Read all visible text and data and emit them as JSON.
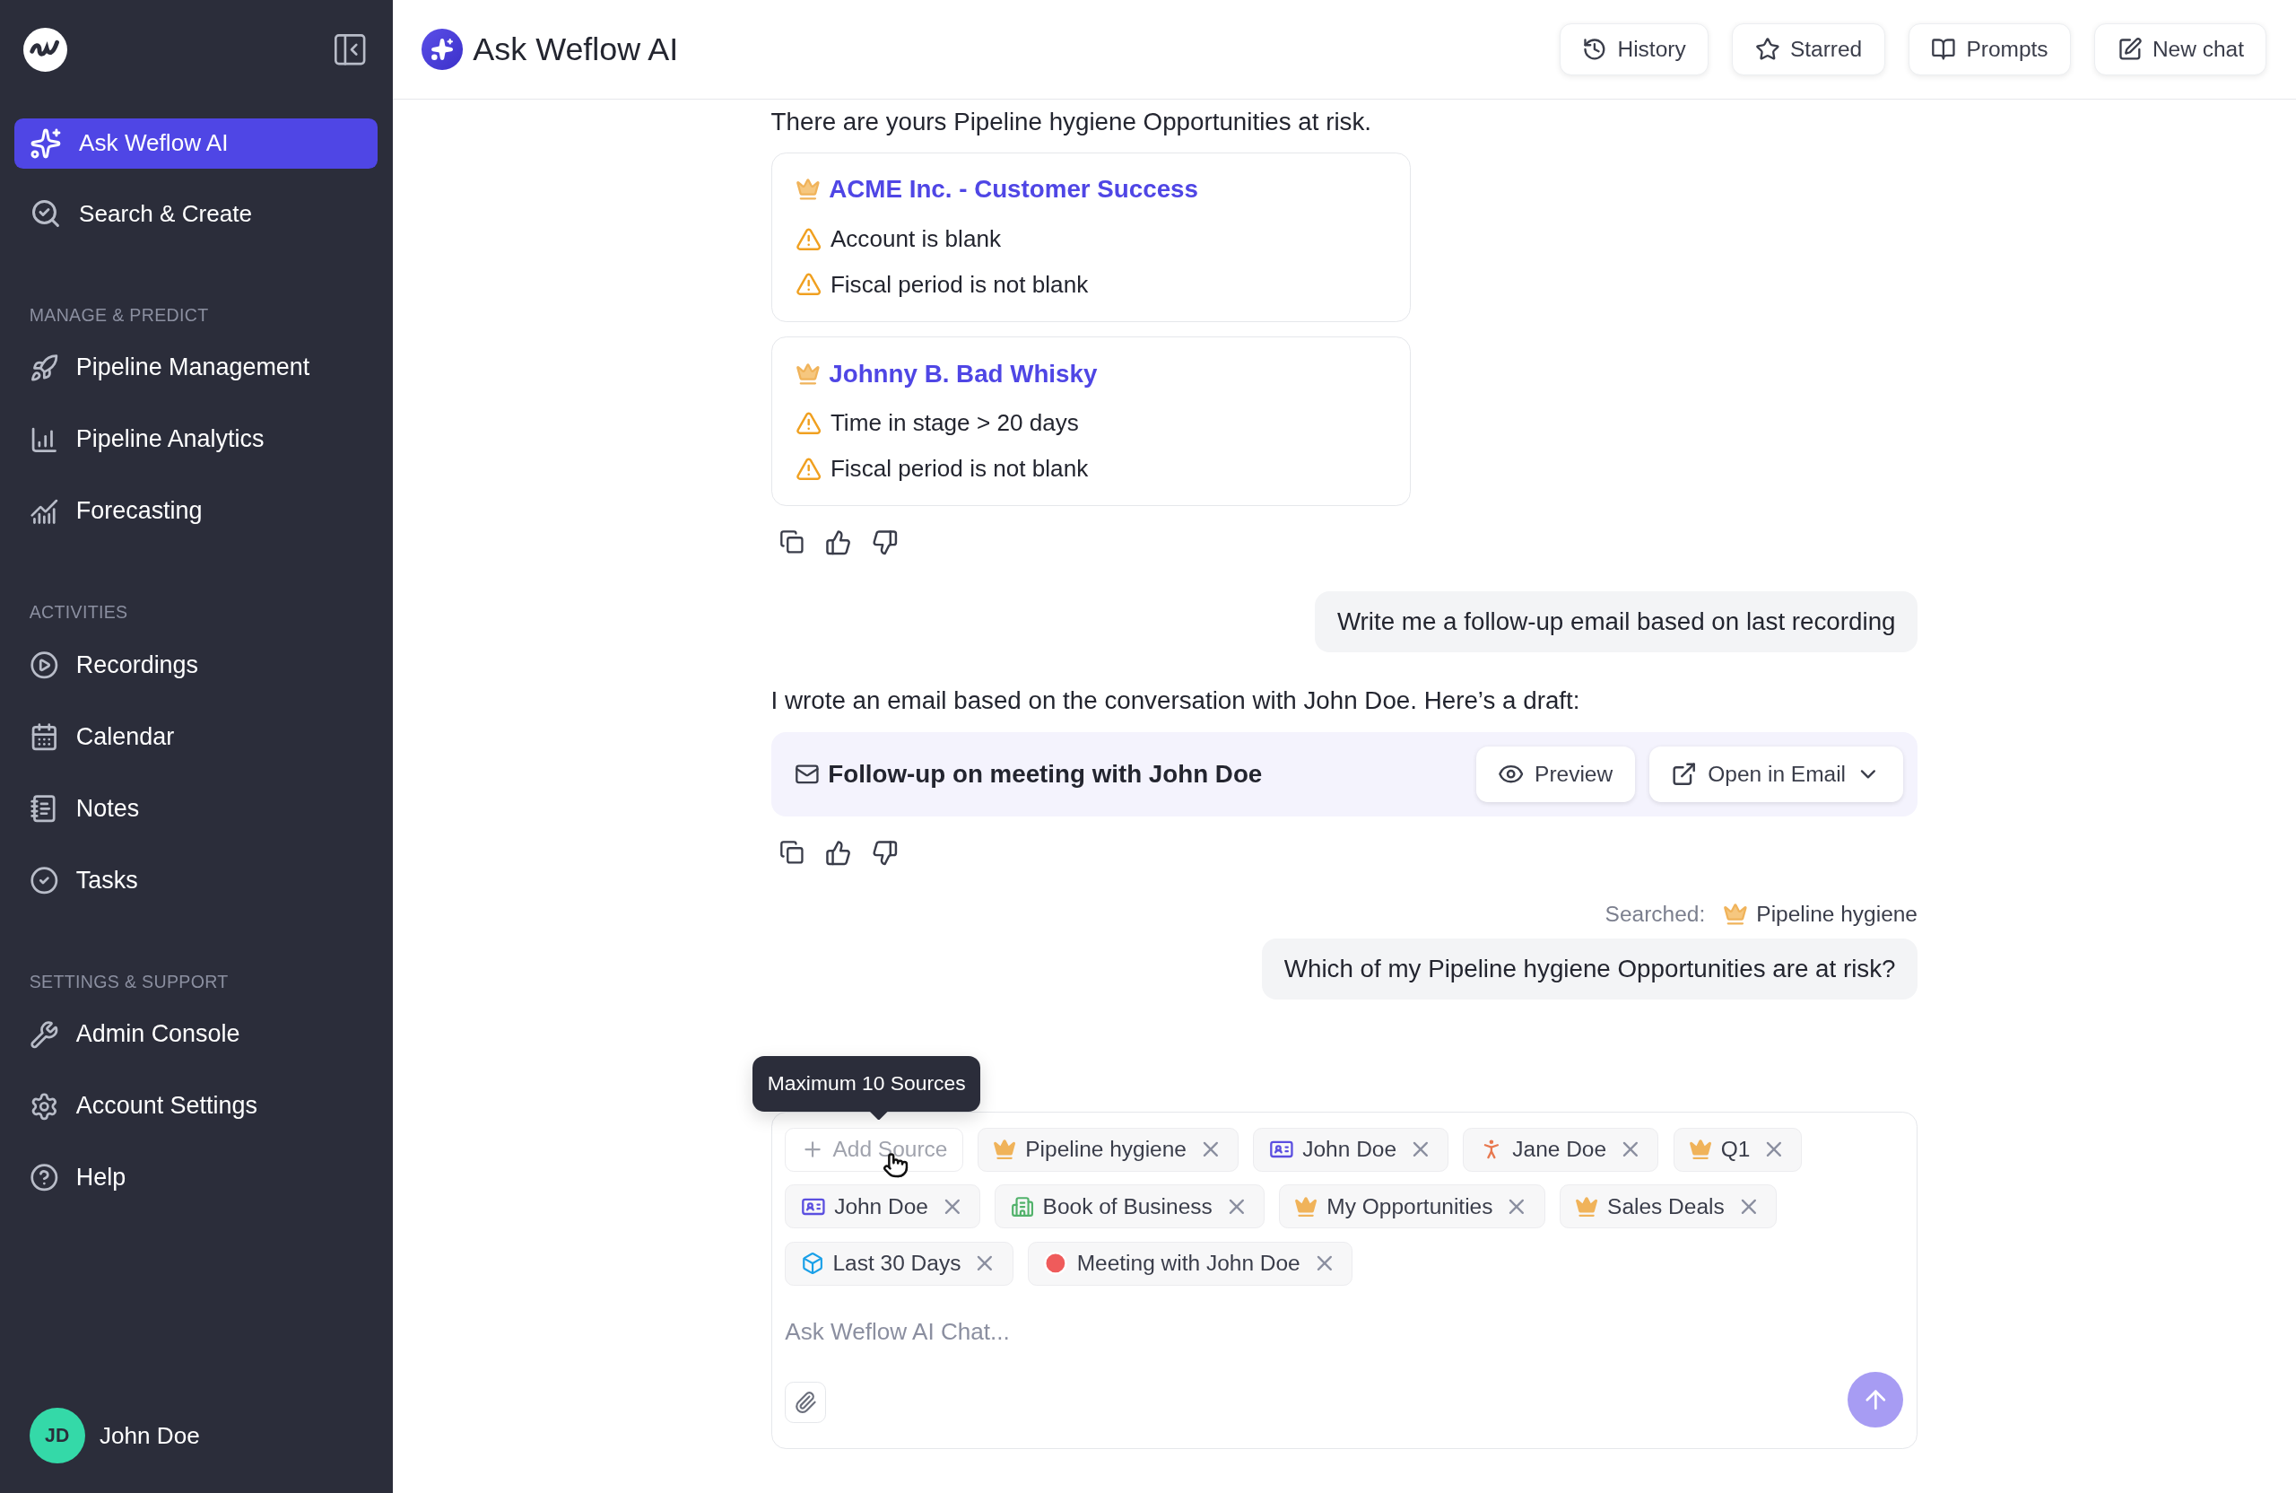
{
  "sidebar": {
    "primary": [
      {
        "label": "Ask Weflow AI",
        "selected": true
      },
      {
        "label": "Search & Create",
        "selected": false
      }
    ],
    "sections": [
      {
        "title": "MANAGE & PREDICT",
        "items": [
          {
            "label": "Pipeline Management",
            "selected": false
          },
          {
            "label": "Pipeline Analytics",
            "selected": false
          },
          {
            "label": "Forecasting",
            "selected": false
          }
        ]
      },
      {
        "title": "ACTIVITIES",
        "items": [
          {
            "label": "Recordings",
            "selected": false
          },
          {
            "label": "Calendar",
            "selected": false
          },
          {
            "label": "Notes",
            "selected": false
          },
          {
            "label": "Tasks",
            "selected": false
          }
        ]
      },
      {
        "title": "SETTINGS & SUPPORT",
        "items": [
          {
            "label": "Admin Console",
            "selected": false
          },
          {
            "label": "Account Settings",
            "selected": false
          },
          {
            "label": "Help",
            "selected": false
          }
        ]
      }
    ],
    "user": {
      "initials": "JD",
      "name": "John Doe"
    }
  },
  "header": {
    "title": "Ask Weflow AI",
    "actions": [
      "History",
      "Starred",
      "Prompts",
      "New chat"
    ]
  },
  "messages": [
    {
      "kind": "assistant",
      "text": "There are yours Pipeline hygiene Opportunities at risk.",
      "opportunities": [
        {
          "title": "ACME Inc. - Customer Success",
          "warnings": [
            "Account is blank",
            "Fiscal period is not blank"
          ]
        },
        {
          "title": "Johnny B. Bad Whisky",
          "warnings": [
            "Time in stage > 20 days",
            "Fiscal period is not blank"
          ]
        }
      ]
    },
    {
      "kind": "user",
      "text": "Write me a follow-up email based on last recording"
    },
    {
      "kind": "assistant",
      "text": "I wrote an email based on the conversation with John Doe. Here’s a draft:",
      "email": {
        "subject": "Follow-up on meeting with John Doe",
        "preview": "Preview",
        "open": "Open in Email"
      }
    },
    {
      "kind": "user",
      "searched_label": "Searched:",
      "searched_source": "Pipeline hygiene",
      "text": "Which of my Pipeline hygiene Opportunities are at risk?"
    }
  ],
  "composer": {
    "tooltip": "Maximum 10 Sources",
    "add_source": {
      "label": "Add Source",
      "disabled": true
    },
    "sources": [
      {
        "kind": "list",
        "label": "Pipeline hygiene"
      },
      {
        "kind": "contact",
        "label": "John Doe"
      },
      {
        "kind": "person",
        "label": "Jane Doe"
      },
      {
        "kind": "list",
        "label": "Q1"
      },
      {
        "kind": "contact",
        "label": "John Doe"
      },
      {
        "kind": "account",
        "label": "Book of Business"
      },
      {
        "kind": "list",
        "label": "My Opportunities"
      },
      {
        "kind": "list",
        "label": "Sales Deals"
      },
      {
        "kind": "date-range",
        "label": "Last 30 Days"
      },
      {
        "kind": "recording",
        "label": "Meeting with John Doe"
      }
    ],
    "placeholder": "Ask Weflow AI Chat...",
    "send_disabled": true
  }
}
